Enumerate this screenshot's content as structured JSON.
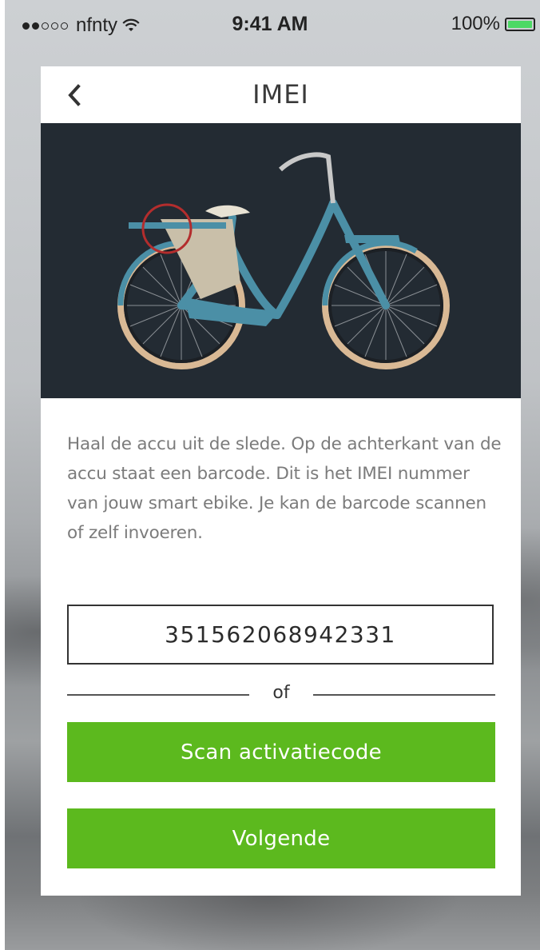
{
  "status_bar": {
    "carrier": "nfnty",
    "time": "9:41 AM",
    "battery": "100%",
    "battery_color": "#4cd964"
  },
  "header": {
    "title": "IMEI",
    "back_icon": "chevron-left-icon"
  },
  "hero": {
    "image": "city-bike-with-highlighted-battery"
  },
  "description": "Haal de accu uit de slede.  Op de achterkant van de accu staat een barcode. Dit is het IMEI nummer van jouw smart ebike. Je kan de barcode scannen of zelf invoeren.",
  "imei_field": {
    "value": "351562068942331"
  },
  "divider_text": "of",
  "buttons": {
    "scan": "Scan activatiecode",
    "next": "Volgende"
  },
  "colors": {
    "accent_green": "#5cb91e",
    "hero_background": "#232b33"
  }
}
